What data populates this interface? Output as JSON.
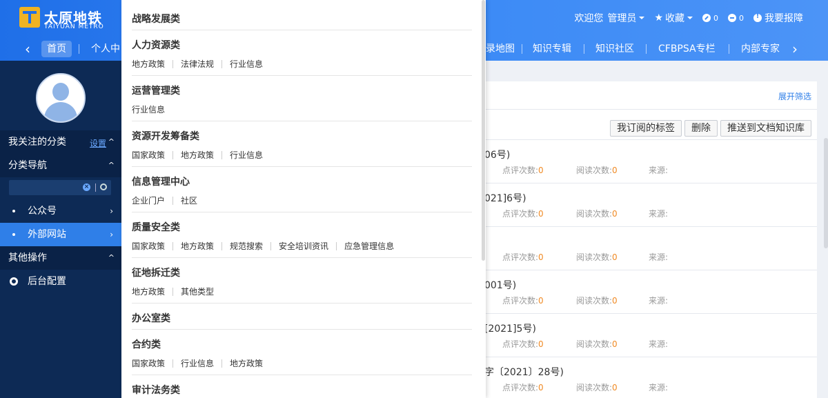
{
  "header": {
    "logo_cn": "太原地铁",
    "logo_en": "TAIYUAN METRO",
    "welcome": "欢迎您",
    "user": "管理员",
    "favorites": "收藏",
    "count_a": "0",
    "count_b": "0",
    "report": "我要报障"
  },
  "nav": {
    "items": [
      "首页",
      "个人中",
      "录地图",
      "知识专辑",
      "知识社区",
      "CFBPSA专栏",
      "内部专家"
    ]
  },
  "sidebar": {
    "follow_title": "我关注的分类",
    "follow_setting": "设置",
    "category_nav": "分类导航",
    "items": [
      "公众号",
      "外部网站"
    ],
    "other_ops": "其他操作",
    "backend": "后台配置"
  },
  "main": {
    "expand_filter": "展开筛选",
    "toolbar": [
      "我订阅的标签",
      "删除",
      "推送到文档知识库"
    ],
    "meta_labels": {
      "comments": "点评次数:",
      "reads": "阅读次数:",
      "source": "来源:"
    },
    "rows": [
      {
        "title": "06号)",
        "comments": "0",
        "reads": "0"
      },
      {
        "title": "021]6号)",
        "comments": "0",
        "reads": "0"
      },
      {
        "title": "",
        "comments": "0",
        "reads": "0"
      },
      {
        "title": "001号)",
        "comments": "0",
        "reads": "0"
      },
      {
        "title": "[2021]5号)",
        "comments": "0",
        "reads": "0"
      },
      {
        "title": "字〔2021〕28号)",
        "comments": "0",
        "reads": "0"
      }
    ]
  },
  "dropdown": {
    "groups": [
      {
        "title": "战略发展类",
        "tags": []
      },
      {
        "title": "人力资源类",
        "tags": [
          "地方政策",
          "法律法规",
          "行业信息"
        ]
      },
      {
        "title": "运营管理类",
        "tags": [
          "行业信息"
        ]
      },
      {
        "title": "资源开发筹备类",
        "tags": [
          "国家政策",
          "地方政策",
          "行业信息"
        ]
      },
      {
        "title": "信息管理中心",
        "tags": [
          "企业门户",
          "社区"
        ]
      },
      {
        "title": "质量安全类",
        "tags": [
          "国家政策",
          "地方政策",
          "规范搜索",
          "安全培训资讯",
          "应急管理信息"
        ]
      },
      {
        "title": "征地拆迁类",
        "tags": [
          "地方政策",
          "其他类型"
        ]
      },
      {
        "title": "办公室类",
        "tags": []
      },
      {
        "title": "合约类",
        "tags": [
          "国家政策",
          "行业信息",
          "地方政策"
        ]
      },
      {
        "title": "审计法务类",
        "tags": []
      }
    ]
  },
  "colors": {
    "header": "#3d8bf6",
    "sidebar": "#0d2a55",
    "accent": "#2f7fe8",
    "count": "#f08a24"
  }
}
